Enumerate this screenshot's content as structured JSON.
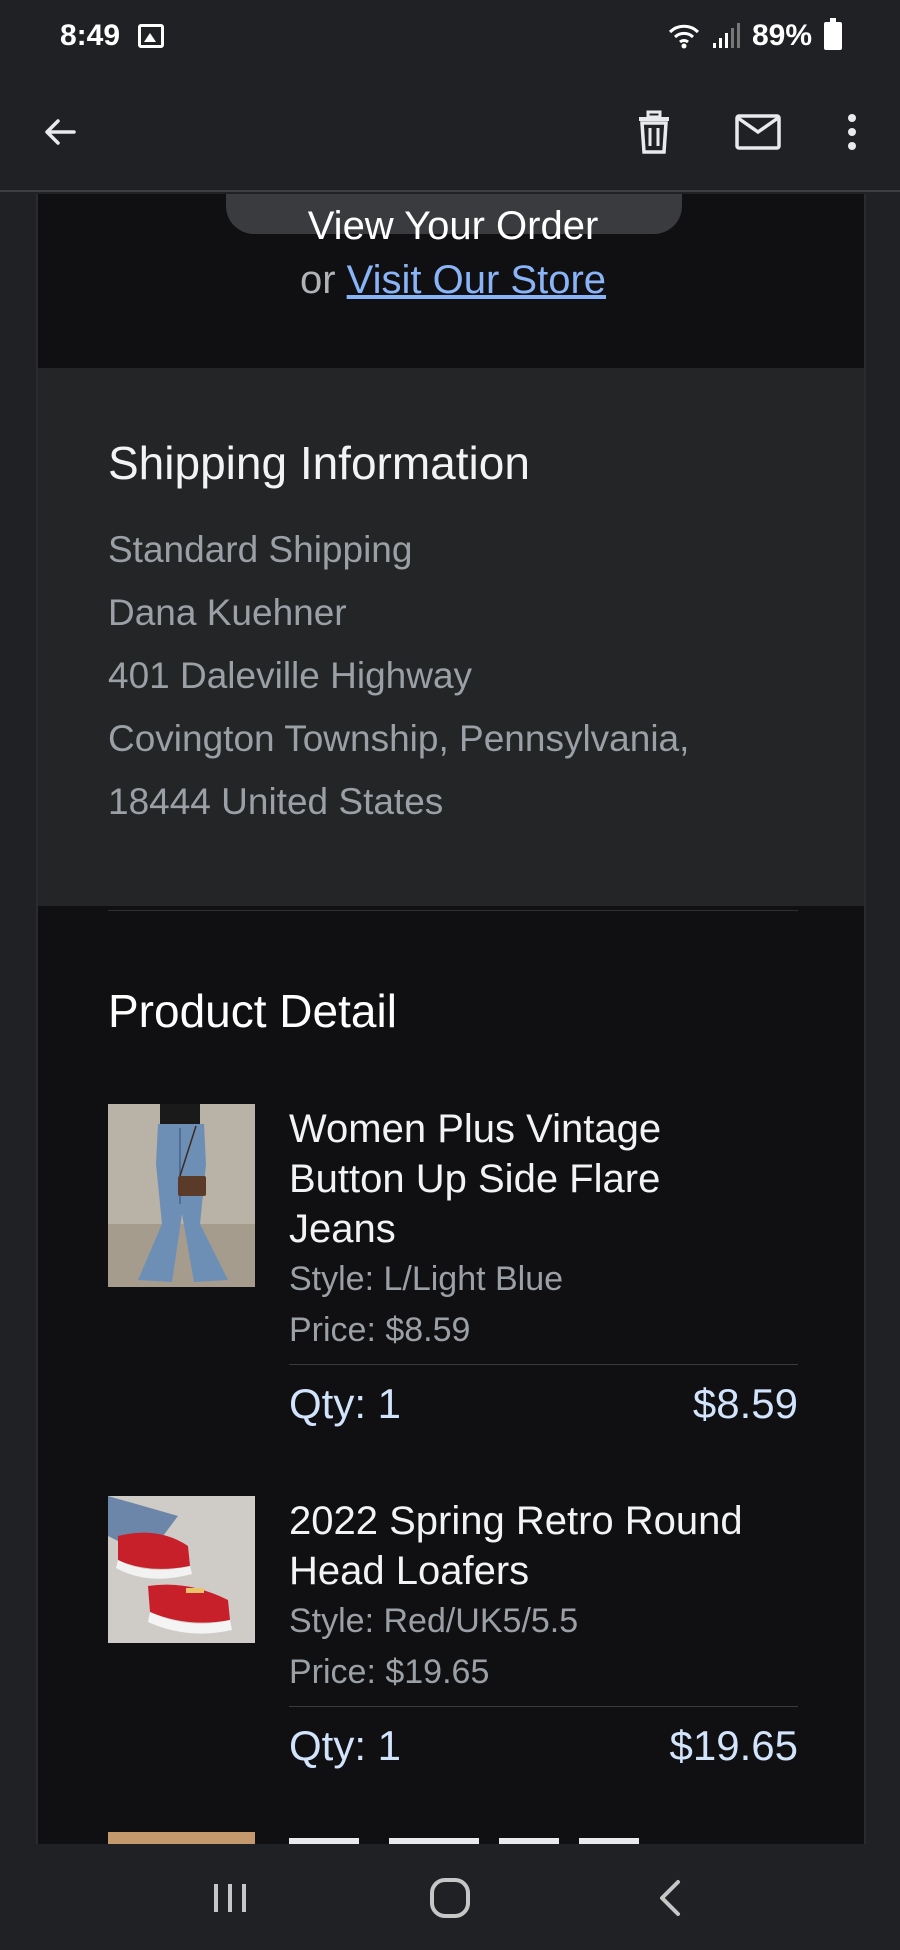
{
  "status_bar": {
    "time": "8:49",
    "battery": "89%",
    "icons": [
      "gallery-icon",
      "wifi-icon",
      "signal-icon",
      "battery-icon"
    ]
  },
  "app_bar": {
    "icons": [
      "back-arrow-icon",
      "delete-icon",
      "mail-icon",
      "more-vert-icon"
    ]
  },
  "email": {
    "view_order": "View Your Order",
    "store_prefix": "or",
    "store_link": "Visit Our Store",
    "shipping": {
      "title": "Shipping Information",
      "lines": [
        "Standard Shipping",
        "Dana Kuehner",
        "401 Daleville Highway",
        "Covington Township, Pennsylvania,",
        "18444 United States"
      ]
    },
    "product_section_title": "Product Detail",
    "products": [
      {
        "name_lines": [
          "Women Plus Vintage",
          "Button Up Side Flare",
          "Jeans"
        ],
        "style": "Style: L/Light Blue",
        "price": "Price: $8.59",
        "qty": "Qty: 1",
        "total": "$8.59"
      },
      {
        "name_lines": [
          "2022 Spring Retro Round",
          "Head Loafers"
        ],
        "style": "Style: Red/UK5/5.5",
        "price": "Price: $19.65",
        "qty": "Qty: 1",
        "total": "$19.65"
      }
    ]
  },
  "colors": {
    "background": "#202124",
    "email_bg": "#101012",
    "shipping_bg": "#242526",
    "link": "#8ab4f8",
    "qty_text": "#d2e3fc"
  },
  "nav_bar": {
    "icons": [
      "recent-apps-icon",
      "home-icon",
      "back-icon"
    ]
  }
}
